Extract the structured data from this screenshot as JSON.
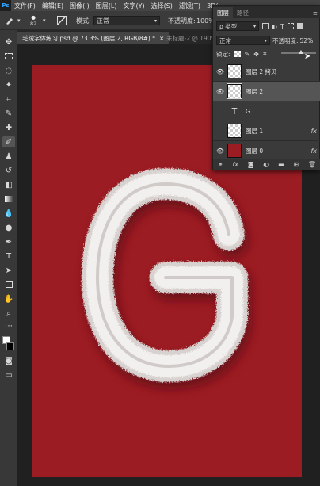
{
  "menu": {
    "logo": "Ps",
    "items": [
      "文件(F)",
      "编辑(E)",
      "图像(I)",
      "图层(L)",
      "文字(Y)",
      "选择(S)",
      "滤镜(T)",
      "3D("
    ]
  },
  "options": {
    "brush_size": "82",
    "mode_label": "模式:",
    "mode_value": "正常",
    "opacity_label": "不透明度:",
    "opacity_value": "100%"
  },
  "tabs": [
    {
      "label": "毛绒字体练习.psd @ 73.3% (图层 2, RGB/8#) *",
      "close": "×"
    },
    {
      "label": "未标题-2 @ 190%",
      "close": ""
    }
  ],
  "layers_panel": {
    "tabs": [
      "图层",
      "路径"
    ],
    "filter_label": "ρ 类型",
    "blend_mode": "正常",
    "opacity_label": "不透明度:",
    "opacity_value": "52%",
    "lock_label": "锁定:",
    "layers": [
      {
        "name": "图层 2 拷贝",
        "visible": true,
        "selected": false,
        "kind": "pixel",
        "fx": false
      },
      {
        "name": "图层 2",
        "visible": true,
        "selected": true,
        "kind": "pixel",
        "fx": false
      },
      {
        "name": "G",
        "visible": false,
        "selected": false,
        "kind": "text",
        "fx": false
      },
      {
        "name": "图层 1",
        "visible": false,
        "selected": false,
        "kind": "checker",
        "fx": true
      },
      {
        "name": "图层 0",
        "visible": true,
        "selected": false,
        "kind": "red",
        "fx": true
      }
    ],
    "fx_label": "fx"
  },
  "canvas": {
    "background_color": "#9c1c23",
    "letter": "G",
    "letter_color": "#ece9e6"
  }
}
